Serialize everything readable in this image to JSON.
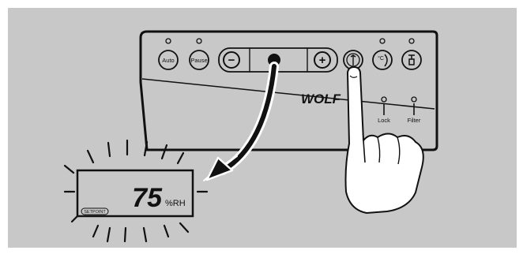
{
  "panel": {
    "brand": "WOLF",
    "buttons": {
      "auto": "Auto",
      "pause": "Pause",
      "minus": "−",
      "plus": "+",
      "temp": "°C"
    },
    "indicators": {
      "lock": "Lock",
      "filter": "Filter"
    }
  },
  "display": {
    "value": "75",
    "unit": "%RH",
    "mode_badge": "SETPOINT"
  }
}
